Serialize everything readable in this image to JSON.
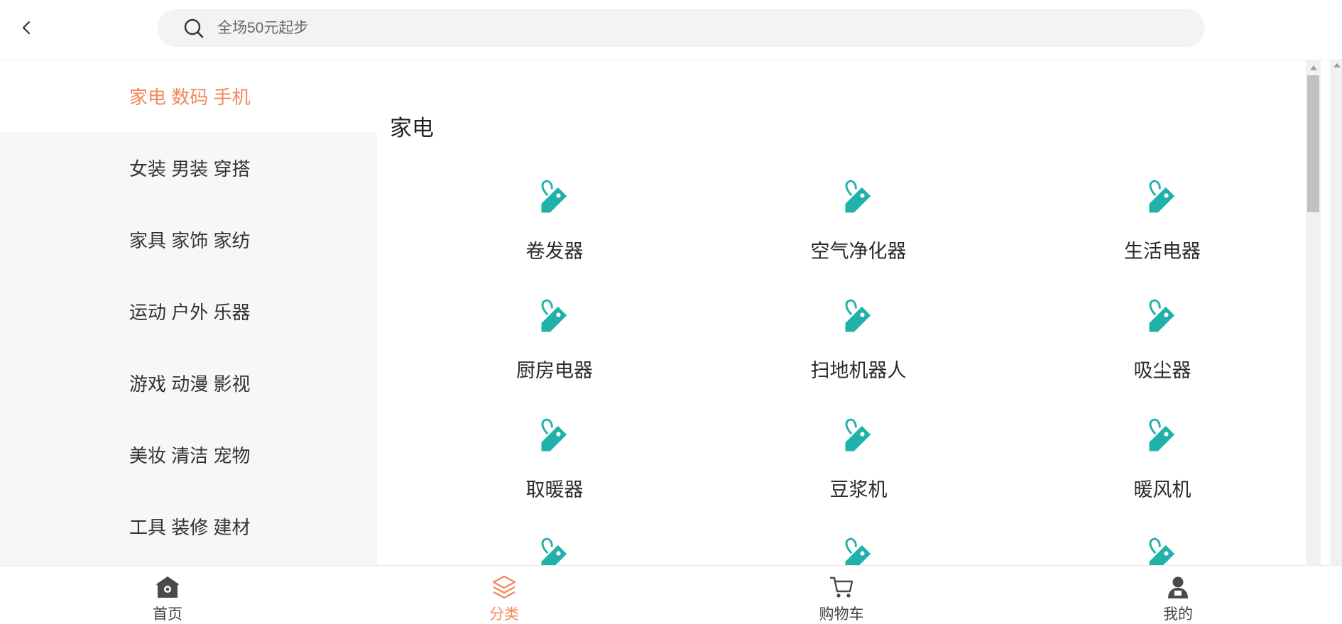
{
  "header": {
    "search_placeholder": "全场50元起步"
  },
  "sidebar": {
    "items": [
      {
        "label": "家电 数码 手机",
        "active": true
      },
      {
        "label": "女装 男装 穿搭",
        "active": false
      },
      {
        "label": "家具 家饰 家纺",
        "active": false
      },
      {
        "label": "运动 户外 乐器",
        "active": false
      },
      {
        "label": "游戏 动漫 影视",
        "active": false
      },
      {
        "label": "美妆 清洁 宠物",
        "active": false
      },
      {
        "label": "工具 装修 建材",
        "active": false
      }
    ]
  },
  "content": {
    "section_title": "家电",
    "items": [
      {
        "label": "卷发器",
        "icon": "tag-icon"
      },
      {
        "label": "空气净化器",
        "icon": "tag-icon"
      },
      {
        "label": "生活电器",
        "icon": "tag-icon"
      },
      {
        "label": "厨房电器",
        "icon": "tag-icon"
      },
      {
        "label": "扫地机器人",
        "icon": "tag-icon"
      },
      {
        "label": "吸尘器",
        "icon": "tag-icon"
      },
      {
        "label": "取暖器",
        "icon": "tag-icon"
      },
      {
        "label": "豆浆机",
        "icon": "tag-icon"
      },
      {
        "label": "暖风机",
        "icon": "tag-icon"
      }
    ]
  },
  "bottom_nav": {
    "items": [
      {
        "label": "首页",
        "icon": "home-icon",
        "active": false
      },
      {
        "label": "分类",
        "icon": "layers-icon",
        "active": true
      },
      {
        "label": "购物车",
        "icon": "cart-icon",
        "active": false
      },
      {
        "label": "我的",
        "icon": "user-icon",
        "active": false
      }
    ]
  },
  "colors": {
    "accent": "#f2875c",
    "icon_teal": "#20b2aa",
    "sidebar_bg": "#f7f7f7",
    "search_bg": "#f3f3f3"
  }
}
